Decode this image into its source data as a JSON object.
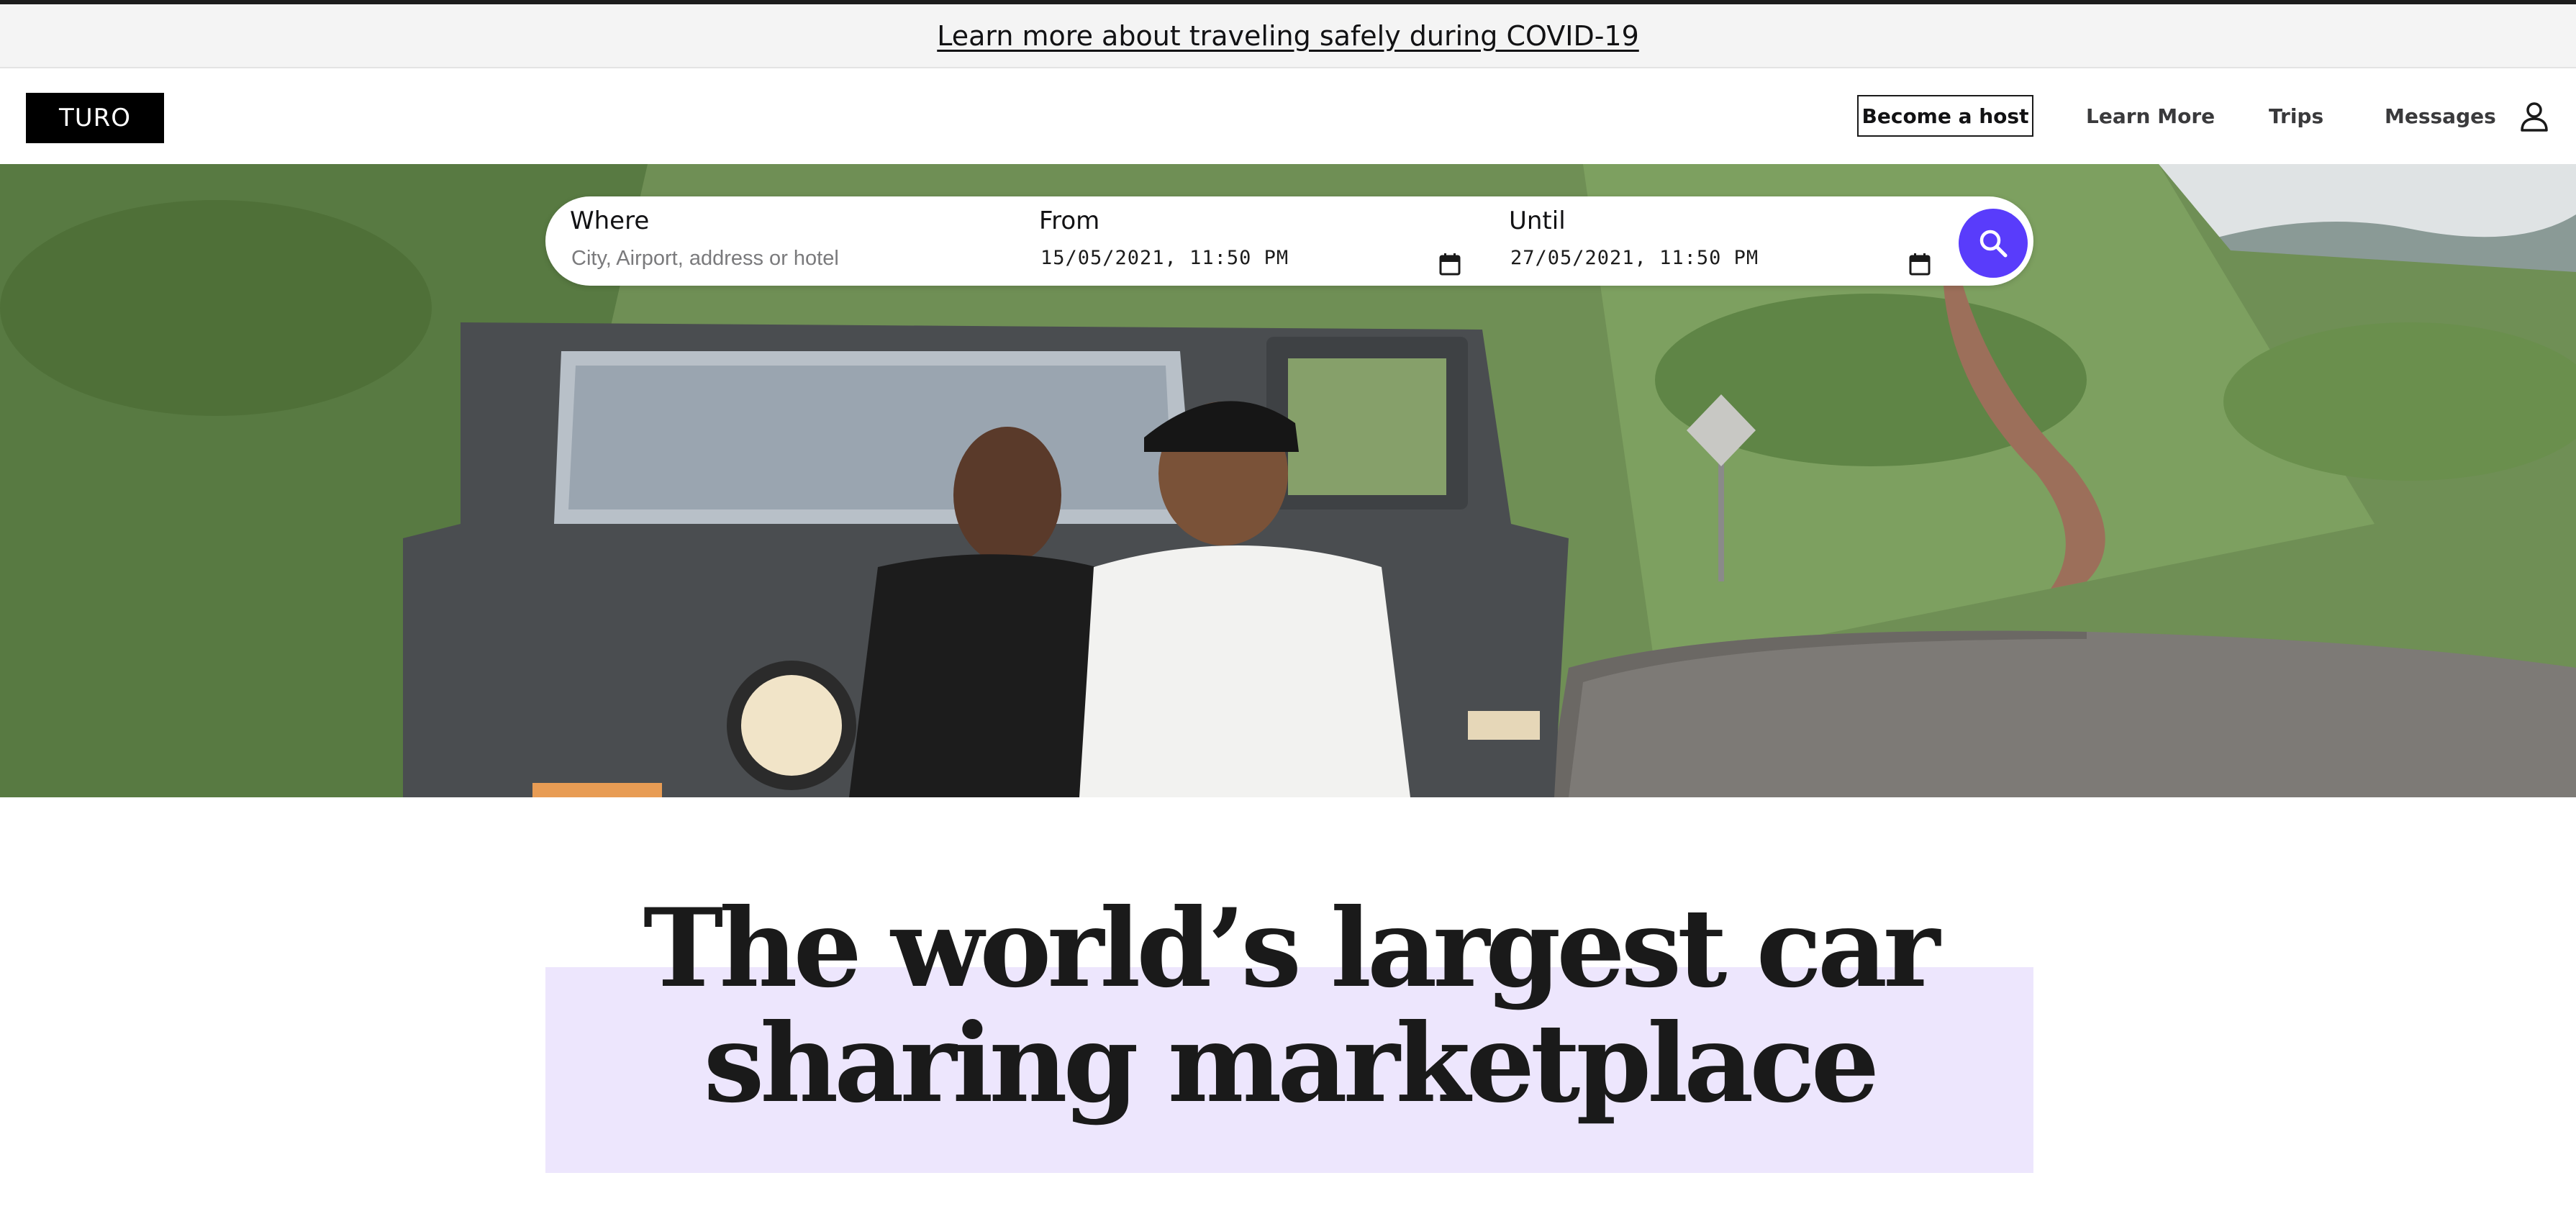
{
  "banner": {
    "link_text": "Learn more about traveling safely during COVID-19"
  },
  "header": {
    "logo": "TURO",
    "nav": {
      "become_host": "Become a host",
      "learn_more": "Learn More",
      "trips": "Trips",
      "messages": "Messages"
    },
    "icons": {
      "account": "user-icon"
    }
  },
  "search": {
    "where": {
      "label": "Where",
      "placeholder": "City, Airport, address or hotel",
      "value": ""
    },
    "from": {
      "label": "From",
      "value": "15/05/2021, 11:50 PM"
    },
    "until": {
      "label": "Until",
      "value": "27/05/2021, 11:50 PM"
    },
    "button_icon": "search-icon",
    "button_color": "#593cfb"
  },
  "hero": {
    "image": "couple leaning on a grey jeep by a winding road"
  },
  "headline": {
    "line1": "The world’s largest car",
    "line2": "sharing marketplace",
    "highlight_color": "#ede6fd"
  }
}
